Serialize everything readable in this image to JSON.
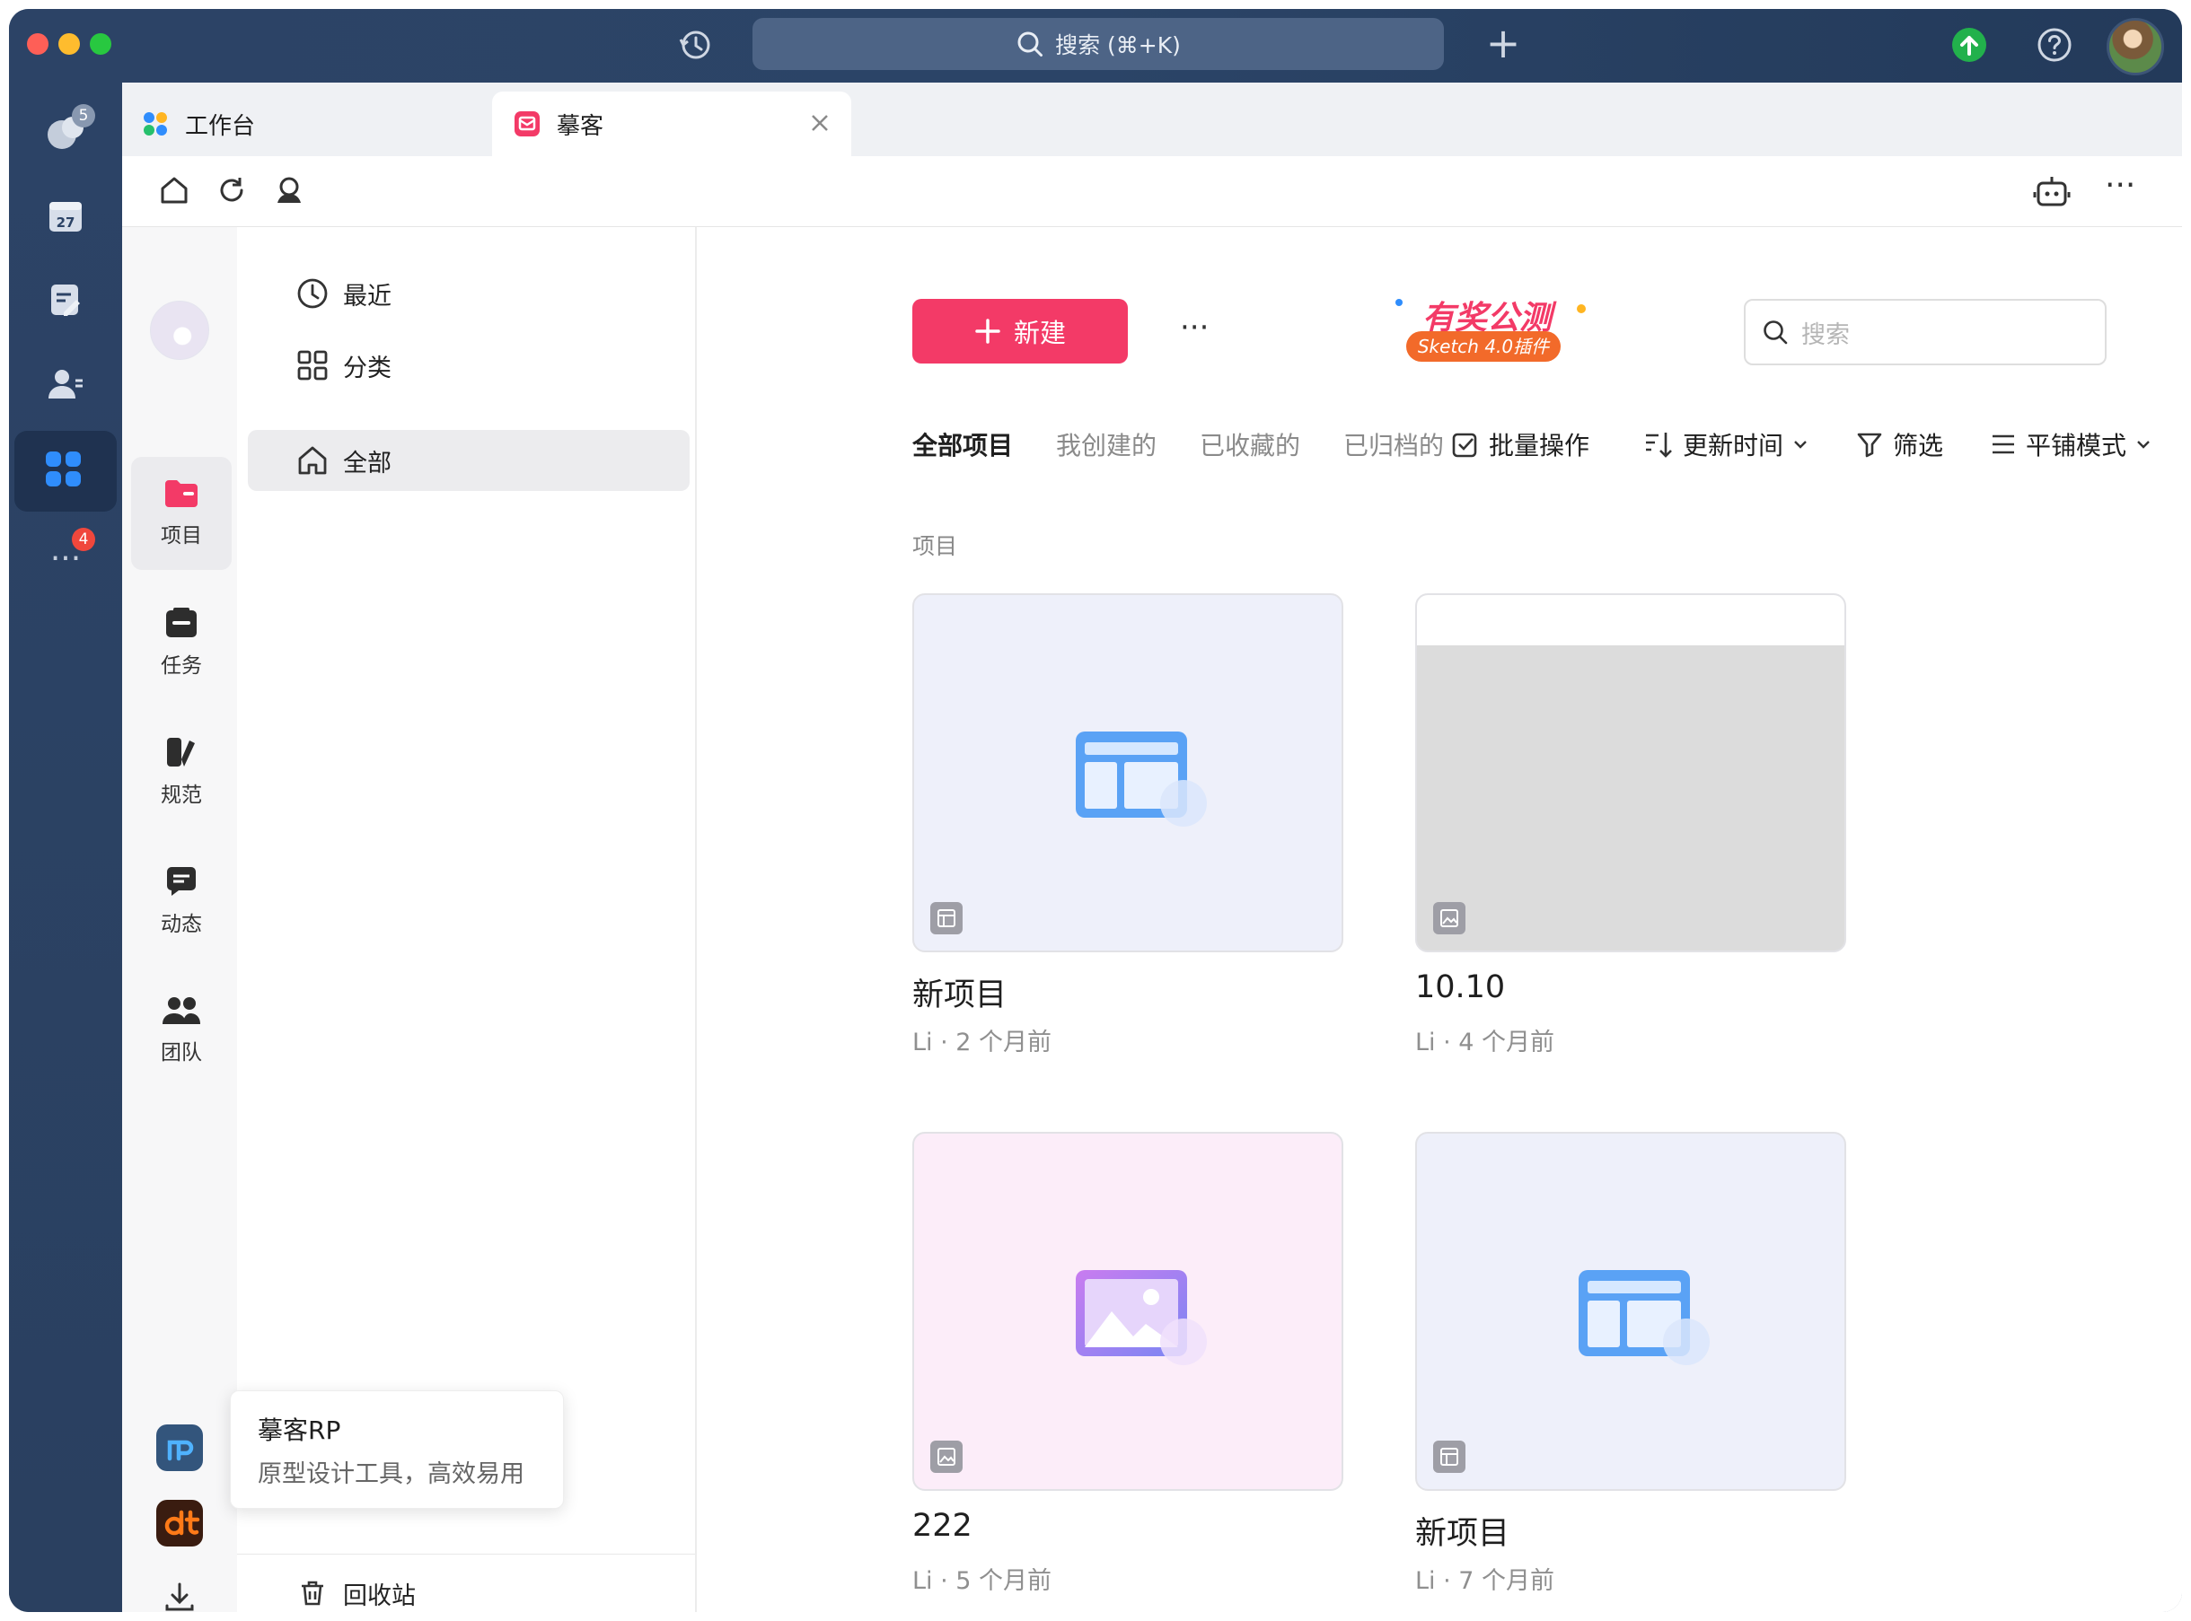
{
  "titlebar": {
    "search_label": "搜索 (⌘+K)",
    "new_tab_symbol": "+"
  },
  "left_rail": {
    "chat_badge": "5",
    "calendar_date": "27",
    "more_badge": "4"
  },
  "tabs": [
    {
      "label": "工作台",
      "icon": "workspace-icon"
    },
    {
      "label": "摹客",
      "icon": "mockplus-icon"
    }
  ],
  "toolbar": {
    "more_symbol": "···"
  },
  "nav": {
    "items": [
      {
        "label": "项目",
        "icon": "project-icon",
        "active": true
      },
      {
        "label": "任务",
        "icon": "task-icon"
      },
      {
        "label": "规范",
        "icon": "spec-icon"
      },
      {
        "label": "动态",
        "icon": "activity-icon"
      },
      {
        "label": "团队",
        "icon": "team-icon"
      }
    ]
  },
  "side": {
    "items": [
      {
        "label": "最近",
        "icon": "clock-icon"
      },
      {
        "label": "分类",
        "icon": "category-icon"
      },
      {
        "label": "全部",
        "icon": "home-icon",
        "active": true
      }
    ],
    "trash_label": "回收站"
  },
  "tooltip": {
    "title": "摹客RP",
    "subtitle": "原型设计工具，高效易用"
  },
  "main": {
    "new_button": "新建",
    "more_symbol": "···",
    "promo": {
      "line1": "有奖公测",
      "line2": "Sketch 4.0插件"
    },
    "search_placeholder": "搜索",
    "filters": [
      "全部项目",
      "我创建的",
      "已收藏的",
      "已归档的"
    ],
    "actions": {
      "batch": "批量操作",
      "sort": "更新时间",
      "filter": "筛选",
      "view": "平铺模式"
    },
    "section_label": "项目",
    "projects": [
      {
        "title": "新项目",
        "meta": "Li · 2 个月前",
        "type": "prototype"
      },
      {
        "title": "10.10",
        "meta": "Li · 4 个月前",
        "type": "image"
      },
      {
        "title": "222",
        "meta": "Li · 5 个月前",
        "type": "image"
      },
      {
        "title": "新项目",
        "meta": "Li · 7 个月前",
        "type": "prototype"
      }
    ]
  },
  "colors": {
    "accent": "#f33a67",
    "rail": "#2c4366",
    "card_blue": "#eef0fa",
    "card_pink": "#fcedf9",
    "card_gray": "#dcdcdc"
  }
}
